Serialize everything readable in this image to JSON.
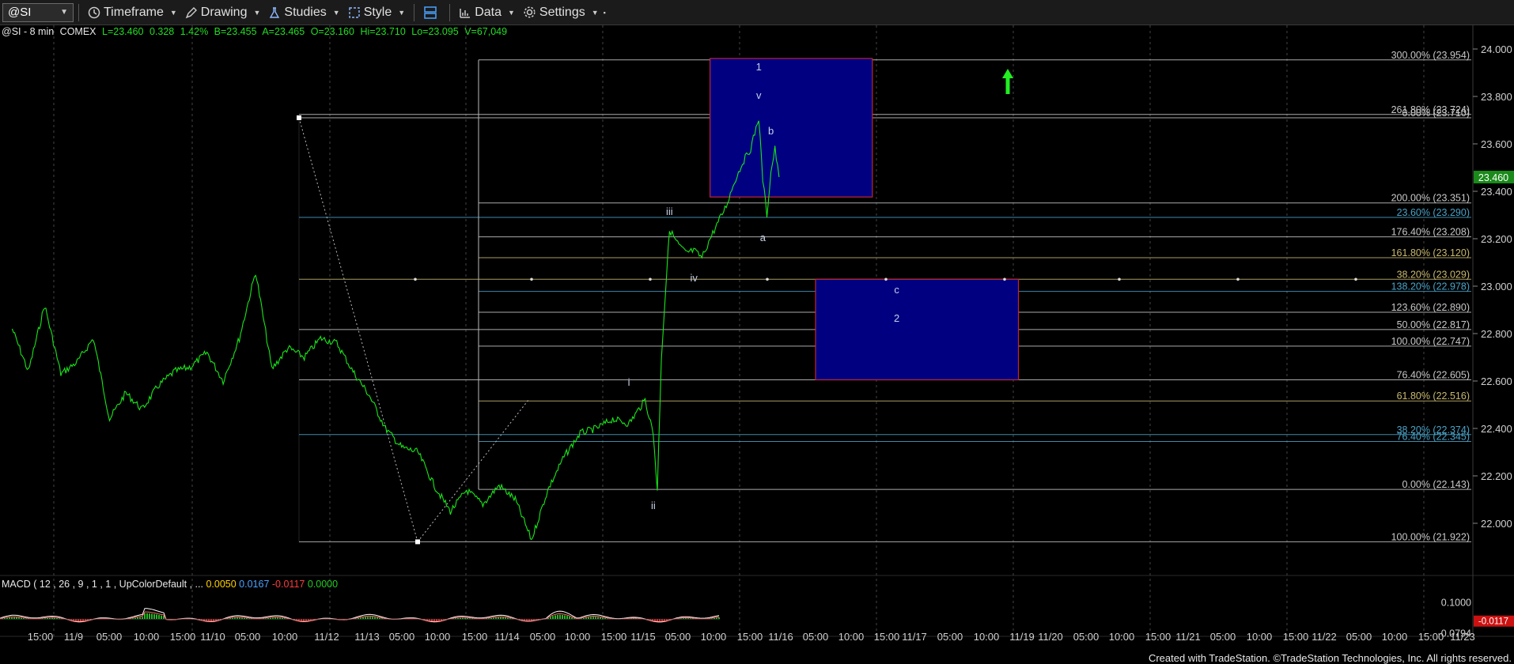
{
  "toolbar": {
    "symbol": "@SI",
    "items": [
      {
        "id": "timeframe",
        "label": "Timeframe",
        "icon": "clock-icon"
      },
      {
        "id": "drawing",
        "label": "Drawing",
        "icon": "pencil-icon"
      },
      {
        "id": "studies",
        "label": "Studies",
        "icon": "flask-icon"
      },
      {
        "id": "style",
        "label": "Style",
        "icon": "style-icon"
      },
      {
        "id": "layout",
        "label": "",
        "icon": "layout-icon"
      },
      {
        "id": "data",
        "label": "Data",
        "icon": "bar-chart-icon"
      },
      {
        "id": "settings",
        "label": "Settings",
        "icon": "gear-icon"
      }
    ]
  },
  "info": {
    "name": "@SI - 8 min",
    "exchange": "COMEX",
    "last": "L=23.460",
    "change": "0.328",
    "pct": "1.42%",
    "bid": "B=23.455",
    "ask": "A=23.465",
    "open": "O=23.160",
    "high": "Hi=23.710",
    "low": "Lo=23.095",
    "volume": "V=67,049"
  },
  "macd": {
    "label": "MACD ( 12 , 26 , 9 , 1 , 1 , UpColorDefault , ...",
    "v1": "0.0050",
    "v2": "0.0167",
    "v3": "-0.0117",
    "v4": "0.0000"
  },
  "footer": "Created with TradeStation. ©TradeStation Technologies, Inc. All rights reserved.",
  "colors": {
    "price": "#19e619",
    "box": "#000080",
    "box_border": "#c0263a",
    "arrow": "#22ee22",
    "last_marker": "#1a8a1a",
    "macd_neg_marker": "#cc1111"
  },
  "chart_data": {
    "type": "line",
    "series": [
      {
        "values": [
          [
            "11/8 12:00",
            22.82
          ],
          [
            "11/8 16:00",
            22.64
          ],
          [
            "11/8 20:00",
            22.92
          ],
          [
            "11/9 00:00",
            22.63
          ],
          [
            "11/9 04:00",
            22.68
          ],
          [
            "11/9 08:00",
            22.78
          ],
          [
            "11/9 12:00",
            22.44
          ],
          [
            "11/9 16:00",
            22.55
          ],
          [
            "11/9 20:00",
            22.48
          ],
          [
            "11/10 00:00",
            22.58
          ],
          [
            "11/10 04:00",
            22.64
          ],
          [
            "11/10 08:00",
            22.66
          ],
          [
            "11/10 12:00",
            22.72
          ],
          [
            "11/10 16:00",
            22.6
          ],
          [
            "11/10 20:00",
            22.78
          ],
          [
            "11/11 00:00",
            23.06
          ],
          [
            "11/11 04:00",
            22.65
          ],
          [
            "11/11 08:00",
            22.74
          ],
          [
            "11/11 12:00",
            22.7
          ],
          [
            "11/11 16:00",
            22.78
          ],
          [
            "11/11 20:00",
            22.76
          ],
          [
            "11/12 00:00",
            22.64
          ],
          [
            "11/12 04:00",
            22.54
          ],
          [
            "11/12 08:00",
            22.4
          ],
          [
            "11/12 12:00",
            22.32
          ],
          [
            "11/12 16:00",
            22.3
          ],
          [
            "11/12 20:00",
            22.16
          ],
          [
            "11/13 00:00",
            22.05
          ],
          [
            "11/13 04:00",
            22.14
          ],
          [
            "11/13 08:00",
            22.08
          ],
          [
            "11/13 12:00",
            22.16
          ],
          [
            "11/13 16:00",
            22.1
          ],
          [
            "11/13 20:00",
            21.93
          ],
          [
            "11/14 00:00",
            22.14
          ],
          [
            "11/14 04:00",
            22.28
          ],
          [
            "11/14 08:00",
            22.38
          ],
          [
            "11/14 12:00",
            22.4
          ],
          [
            "11/14 16:00",
            22.44
          ],
          [
            "11/14 20:00",
            22.42
          ],
          [
            "11/15 00:00",
            22.52
          ],
          [
            "11/15 02:00",
            22.38
          ],
          [
            "11/15 03:00",
            22.14
          ],
          [
            "11/15 04:00",
            22.7
          ],
          [
            "11/15 06:00",
            23.24
          ],
          [
            "11/15 08:00",
            23.18
          ],
          [
            "11/15 10:00",
            23.14
          ],
          [
            "11/15 12:00",
            23.15
          ],
          [
            "11/15 14:00",
            23.12
          ],
          [
            "11/15 16:00",
            23.2
          ],
          [
            "11/15 18:00",
            23.27
          ],
          [
            "11/15 20:00",
            23.34
          ],
          [
            "11/15 22:00",
            23.44
          ],
          [
            "11/16 00:00",
            23.52
          ],
          [
            "11/16 02:00",
            23.58
          ],
          [
            "11/16 04:00",
            23.71
          ],
          [
            "11/16 05:00",
            23.45
          ],
          [
            "11/16 06:00",
            23.3
          ],
          [
            "11/16 07:00",
            23.48
          ],
          [
            "11/16 08:00",
            23.58
          ],
          [
            "11/16 09:00",
            23.46
          ]
        ]
      }
    ],
    "y_axis": {
      "range": [
        21.78,
        24.1
      ],
      "ticks": [
        "24.000",
        "23.800",
        "23.600",
        "23.400",
        "23.200",
        "23.000",
        "22.800",
        "22.600",
        "22.400",
        "22.200",
        "22.000"
      ],
      "side": "right"
    },
    "x_axis": {
      "ticks": [
        "15:00",
        "11/9",
        "05:00",
        "10:00",
        "15:00",
        "11/10",
        "05:00",
        "10:00",
        "11/12",
        "11/13",
        "05:00",
        "10:00",
        "15:00",
        "11/14",
        "05:00",
        "10:00",
        "15:00",
        "11/15",
        "05:00",
        "10:00",
        "15:00",
        "11/16",
        "05:00",
        "10:00",
        "15:00",
        "11/17",
        "05:00",
        "10:00",
        "11/19",
        "11/20",
        "05:00",
        "10:00",
        "15:00",
        "11/21",
        "05:00",
        "10:00",
        "15:00",
        "11/22",
        "05:00",
        "10:00",
        "15:00",
        "11/23"
      ]
    },
    "last_price": "23.460",
    "fib_levels": [
      {
        "label": "300.00% (23.954)",
        "value": 23.954,
        "color": "#c8c8c8"
      },
      {
        "label": "261.80% (23.724)",
        "value": 23.724,
        "color": "#c8c8c8"
      },
      {
        "label": "0.00% (23.710)",
        "value": 23.71,
        "color": "#c8c8c8"
      },
      {
        "label": "200.00% (23.351)",
        "value": 23.351,
        "color": "#c8c8c8"
      },
      {
        "label": "23.60% (23.290)",
        "value": 23.29,
        "color": "#4aa3c8"
      },
      {
        "label": "176.40% (23.208)",
        "value": 23.208,
        "color": "#c8c8c8"
      },
      {
        "label": "161.80% (23.120)",
        "value": 23.12,
        "color": "#c8b870"
      },
      {
        "label": "38.20% (23.029)",
        "value": 23.029,
        "color": "#c8b870"
      },
      {
        "label": "138.20% (22.978)",
        "value": 22.978,
        "color": "#4aa3c8"
      },
      {
        "label": "123.60% (22.890)",
        "value": 22.89,
        "color": "#c8c8c8"
      },
      {
        "label": "50.00% (22.817)",
        "value": 22.817,
        "color": "#c8c8c8"
      },
      {
        "label": "100.00% (22.747)",
        "value": 22.747,
        "color": "#c8c8c8"
      },
      {
        "label": "76.40% (22.605)",
        "value": 22.605,
        "color": "#c8c8c8"
      },
      {
        "label": "61.80% (22.516)",
        "value": 22.516,
        "color": "#c8b870"
      },
      {
        "label": "38.20% (22.374)",
        "value": 22.374,
        "color": "#4aa3c8"
      },
      {
        "label": "76.40% (22.345)",
        "value": 22.345,
        "color": "#4aa3c8"
      },
      {
        "label": "0.00% (22.143)",
        "value": 22.143,
        "color": "#c8c8c8"
      },
      {
        "label": "100.00% (21.922)",
        "value": 21.922,
        "color": "#c8c8c8"
      }
    ],
    "wave_labels": [
      {
        "text": "1",
        "x": "11/16 04:00",
        "y": 23.91
      },
      {
        "text": "v",
        "x": "11/16 04:00",
        "y": 23.79
      },
      {
        "text": "b",
        "x": "11/16 07:00",
        "y": 23.64
      },
      {
        "text": "a",
        "x": "11/16 05:00",
        "y": 23.19
      },
      {
        "text": "iii",
        "x": "11/15 06:00",
        "y": 23.3
      },
      {
        "text": "iv",
        "x": "11/15 12:00",
        "y": 23.02
      },
      {
        "text": "i",
        "x": "11/14 20:00",
        "y": 22.58
      },
      {
        "text": "ii",
        "x": "11/15 02:00",
        "y": 22.06
      },
      {
        "text": "c",
        "x": "11/17 14:00",
        "y": 22.97
      },
      {
        "text": "2",
        "x": "11/17 14:00",
        "y": 22.85
      }
    ],
    "boxes": [
      {
        "name": "upper-target-box",
        "x": [
          "11/15 16:00",
          "11/17 08:00"
        ],
        "y": [
          23.376,
          23.96
        ]
      },
      {
        "name": "lower-target-box",
        "x": [
          "11/16 18:00",
          "11/18 20:00"
        ],
        "y": [
          22.605,
          23.029
        ]
      }
    ],
    "macd_axis": {
      "ticks": [
        "0.1000",
        "-0.0794"
      ],
      "marker": "-0.0117"
    }
  }
}
